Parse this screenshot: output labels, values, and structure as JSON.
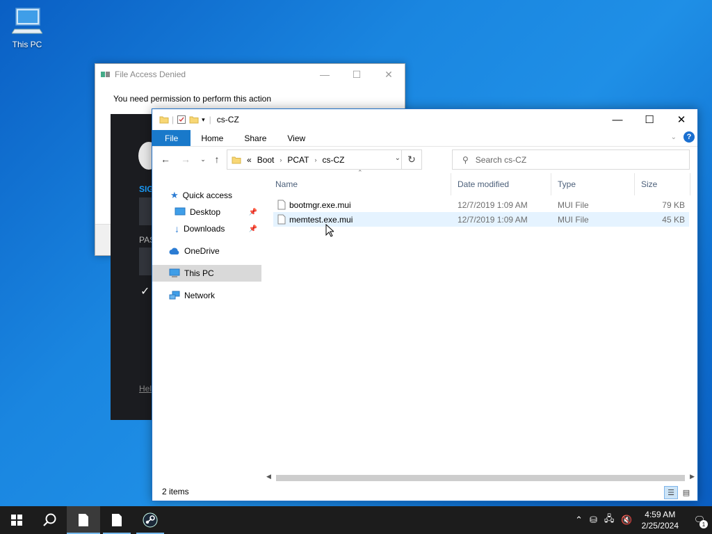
{
  "desktop": {
    "this_pc_label": "This PC"
  },
  "dialog": {
    "title": "File Access Denied",
    "message": "You need permission to perform this action"
  },
  "steam": {
    "sign_in_partial": "SIG",
    "password_partial": "PAS",
    "help_partial": "Hel"
  },
  "explorer": {
    "title": "cs-CZ",
    "ribbon_tabs": [
      "File",
      "Home",
      "Share",
      "View"
    ],
    "breadcrumb": {
      "overflow": "«",
      "items": [
        "Boot",
        "PCAT",
        "cs-CZ"
      ]
    },
    "search_placeholder": "Search cs-CZ",
    "sidebar": {
      "quick_access": "Quick access",
      "desktop": "Desktop",
      "downloads": "Downloads",
      "onedrive": "OneDrive",
      "this_pc": "This PC",
      "network": "Network"
    },
    "columns": {
      "name": "Name",
      "date_modified": "Date modified",
      "type": "Type",
      "size": "Size"
    },
    "files": [
      {
        "name": "bootmgr.exe.mui",
        "date": "12/7/2019 1:09 AM",
        "type": "MUI File",
        "size": "79 KB"
      },
      {
        "name": "memtest.exe.mui",
        "date": "12/7/2019 1:09 AM",
        "type": "MUI File",
        "size": "45 KB"
      }
    ],
    "status": "2 items"
  },
  "taskbar": {
    "time": "4:59 AM",
    "date": "2/25/2024",
    "notification_count": "1"
  },
  "colors": {
    "accent": "#1979ca",
    "taskbar": "#1c1c1c",
    "hover_row": "#e5f3ff"
  }
}
